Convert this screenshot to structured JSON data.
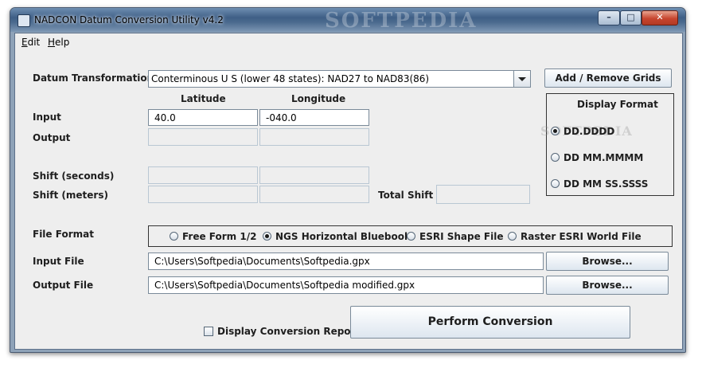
{
  "window": {
    "title": "NADCON Datum Conversion Utility v4.2",
    "watermark": "SOFTPEDIA",
    "minimize_glyph": "–",
    "maximize_glyph": "□",
    "close_glyph": "✕"
  },
  "menu": [
    {
      "label": "Edit",
      "mnemonic": "E",
      "rest": "dit"
    },
    {
      "label": "Help",
      "mnemonic": "H",
      "rest": "elp"
    }
  ],
  "datum": {
    "label": "Datum Transformation",
    "selected": "Conterminous U S (lower 48 states): NAD27 to NAD83(86)",
    "add_remove_label": "Add / Remove Grids"
  },
  "coords": {
    "latitude_header": "Latitude",
    "longitude_header": "Longitude",
    "input_label": "Input",
    "output_label": "Output",
    "shift_seconds_label": "Shift (seconds)",
    "shift_meters_label": "Shift (meters)",
    "total_shift_label": "Total Shift",
    "input_latitude": "40.0",
    "input_longitude": "-040.0",
    "output_latitude": "",
    "output_longitude": "",
    "shift_seconds_latitude": "",
    "shift_seconds_longitude": "",
    "shift_meters_latitude": "",
    "shift_meters_longitude": "",
    "total_shift": ""
  },
  "display_format": {
    "title": "Display Format",
    "options": [
      "DD.DDDD",
      "DD MM.MMMM",
      "DD MM SS.SSSS"
    ],
    "selected_index": 0,
    "watermark": "SOFTPEDIA"
  },
  "file_format": {
    "label": "File Format",
    "options": [
      "Free Form 1/2",
      "NGS Horizontal Bluebook",
      "ESRI Shape File",
      "Raster ESRI World File"
    ],
    "selected_index": 1
  },
  "files": {
    "input_label": "Input File",
    "input_value": "C:\\Users\\Softpedia\\Documents\\Softpedia.gpx",
    "output_label": "Output File",
    "output_value": "C:\\Users\\Softpedia\\Documents\\Softpedia modified.gpx",
    "browse_label": "Browse..."
  },
  "actions": {
    "report_label": "Display Conversion Report",
    "report_checked": false,
    "perform_label": "Perform Conversion"
  }
}
